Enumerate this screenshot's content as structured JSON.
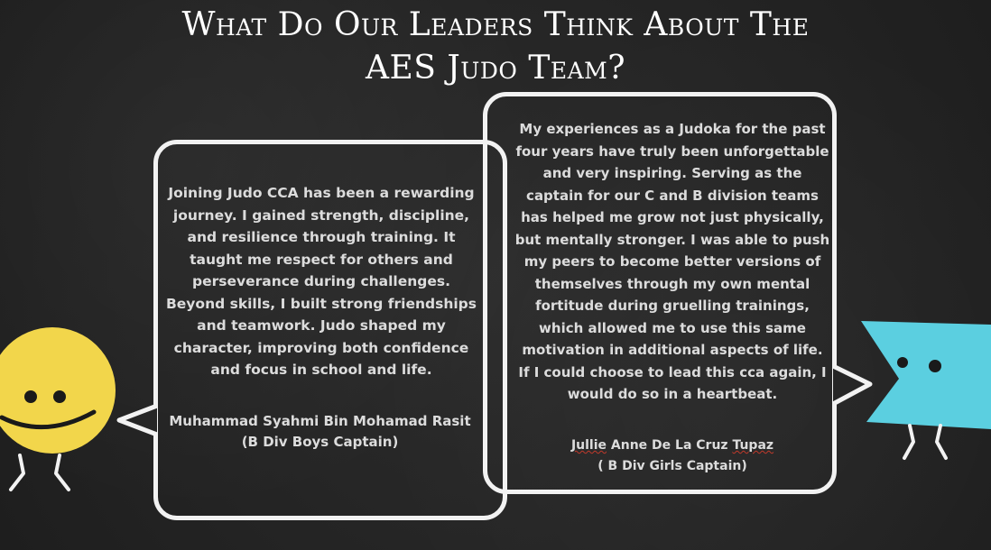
{
  "title": {
    "line1": "What Do Our Leaders Think About The",
    "line2": "AES Judo Team?"
  },
  "left_bubble": {
    "quote": "Joining Judo CCA has been a rewarding journey. I gained strength, discipline, and resilience through training. It taught me respect for others and perseverance during challenges. Beyond skills, I built strong friendships and teamwork. Judo shaped my character, improving both confidence and focus in school and life.",
    "name": "Muhammad Syahmi Bin Mohamad Rasit",
    "role": "(B Div Boys Captain)"
  },
  "right_bubble": {
    "quote": "My experiences as a Judoka for the past four years have truly been unforgettable and very inspiring. Serving as the captain for our C and B division teams has helped me grow not just physically, but mentally stronger. I was able to push my peers to become better versions of themselves through my own mental fortitude during gruelling trainings, which allowed me to use this same motivation in additional aspects of life. If I could choose to lead this cca again, I would do so in a heartbeat.",
    "name_first": "Jullie",
    "name_rest": " Anne De La Cruz ",
    "name_last": "Tupaz",
    "role": "( B Div Girls Captain)"
  },
  "colors": {
    "background": "#262626",
    "chalk": "#f2f2f2",
    "yellow_character": "#f2d64b",
    "blue_character": "#5bcfe0"
  }
}
